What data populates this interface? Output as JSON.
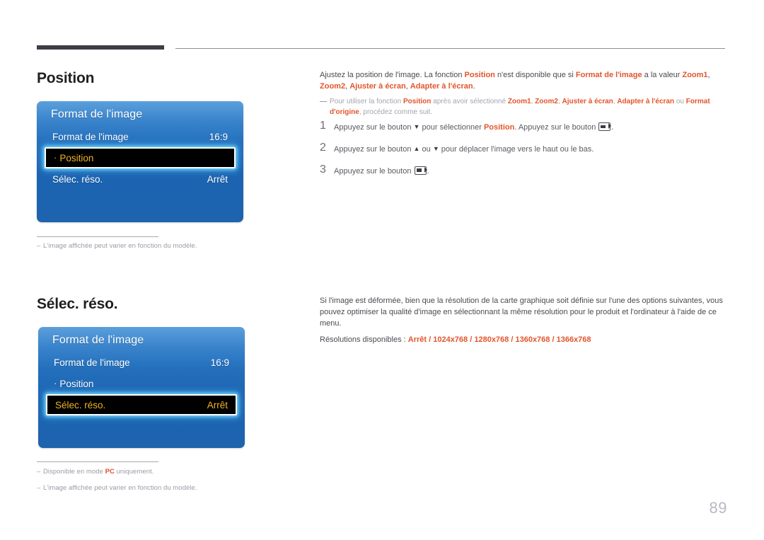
{
  "page": {
    "number": "89"
  },
  "sections": [
    {
      "title": "Position",
      "menu": {
        "header": "Format de l'image",
        "rows": [
          {
            "label": "Format de l'image",
            "value": "16:9",
            "selected": false,
            "bullet": false
          },
          {
            "label": "Position",
            "value": "",
            "selected": true,
            "bullet": true
          },
          {
            "label": "Sélec. réso.",
            "value": "Arrêt",
            "selected": false,
            "bullet": false
          }
        ]
      },
      "notes": [
        "L'image affichée peut varier en fonction du modèle."
      ]
    },
    {
      "title": "Sélec. réso.",
      "menu": {
        "header": "Format de l'image",
        "rows": [
          {
            "label": "Format de l'image",
            "value": "16:9",
            "selected": false,
            "bullet": false
          },
          {
            "label": "Position",
            "value": "",
            "selected": false,
            "bullet": true
          },
          {
            "label": "Sélec. réso.",
            "value": "Arrêt",
            "selected": true,
            "bullet": false
          }
        ]
      },
      "notes": [
        "Disponible en mode PC uniquement.",
        "L'image affichée peut varier en fonction du modèle."
      ]
    }
  ],
  "right_column": {
    "top": {
      "paragraph_parts": [
        {
          "t": "Ajustez la position de l'image. La fonction ",
          "o": false
        },
        {
          "t": "Position",
          "o": true
        },
        {
          "t": " n'est disponible que si ",
          "o": false
        },
        {
          "t": "Format de l'image",
          "o": true
        },
        {
          "t": " a la valeur ",
          "o": false
        },
        {
          "t": "Zoom1",
          "o": true
        },
        {
          "t": ", ",
          "o": false
        },
        {
          "t": "Zoom2",
          "o": true
        },
        {
          "t": ", ",
          "o": false
        },
        {
          "t": "Ajuster à écran",
          "o": true
        },
        {
          "t": ", ",
          "o": false
        },
        {
          "t": "Adapter à l'écran",
          "o": true
        },
        {
          "t": ".",
          "o": false
        }
      ],
      "subnote_parts": [
        {
          "t": "Pour utiliser la fonction ",
          "o": false
        },
        {
          "t": "Position",
          "o": true
        },
        {
          "t": " après avoir sélectionné ",
          "o": false
        },
        {
          "t": "Zoom1",
          "o": true
        },
        {
          "t": ", ",
          "o": false
        },
        {
          "t": "Zoom2",
          "o": true
        },
        {
          "t": ", ",
          "o": false
        },
        {
          "t": "Ajuster à écran",
          "o": true
        },
        {
          "t": ", ",
          "o": false
        },
        {
          "t": "Adapter à l'écran",
          "o": true
        },
        {
          "t": " ou ",
          "o": false
        },
        {
          "t": "Format d'origine",
          "o": true
        },
        {
          "t": ", procédez comme suit.",
          "o": false
        }
      ]
    },
    "steps": [
      {
        "num": "1",
        "parts": [
          {
            "t": "Appuyez sur le bouton ",
            "o": false
          },
          {
            "t": "▼",
            "o": false,
            "tri": true
          },
          {
            "t": " pour sélectionner ",
            "o": false
          },
          {
            "t": "Position",
            "o": true
          },
          {
            "t": ". Appuyez sur le bouton ",
            "o": false
          },
          {
            "t": "",
            "o": false,
            "key": true
          },
          {
            "t": ".",
            "o": false
          }
        ]
      },
      {
        "num": "2",
        "parts": [
          {
            "t": "Appuyez sur le bouton ",
            "o": false
          },
          {
            "t": "▲",
            "o": false,
            "tri": true
          },
          {
            "t": " ou ",
            "o": false
          },
          {
            "t": "▼",
            "o": false,
            "tri": true
          },
          {
            "t": " pour déplacer l'image vers le haut ou le bas.",
            "o": false
          }
        ]
      },
      {
        "num": "3",
        "parts": [
          {
            "t": "Appuyez sur le bouton ",
            "o": false
          },
          {
            "t": "",
            "o": false,
            "key": true
          },
          {
            "t": ".",
            "o": false
          }
        ]
      }
    ],
    "bottom": {
      "paragraph_parts": [
        {
          "t": "Si l'image est déformée, bien que la résolution de la carte graphique soit définie sur l'une des options suivantes, vous pouvez optimiser la qualité d'image en sélectionnant la même résolution pour le produit et l'ordinateur à l'aide de ce menu.",
          "o": false
        }
      ],
      "resolutions_label": "Résolutions disponibles : ",
      "resolutions": [
        "Arrêt",
        "1024x768",
        "1280x768",
        "1360x768",
        "1366x768"
      ]
    }
  }
}
